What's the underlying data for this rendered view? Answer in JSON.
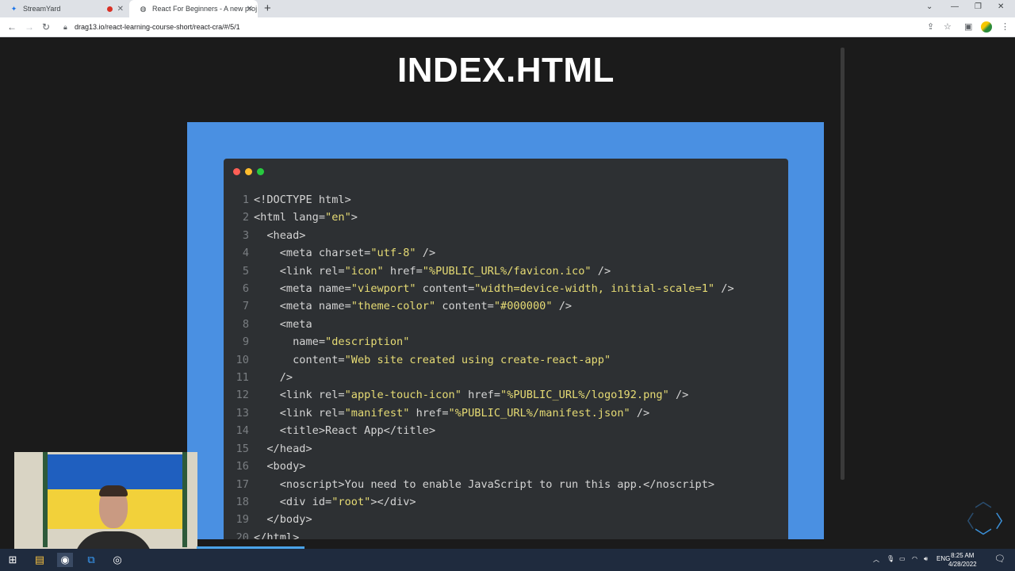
{
  "browser": {
    "tabs": [
      {
        "title": "StreamYard",
        "recording": true
      },
      {
        "title": "React For Beginners - A new proj",
        "active": true
      }
    ],
    "url": "drag13.io/react-learning-course-short/react-cra/#/5/1"
  },
  "slide": {
    "title": "INDEX.HTML",
    "code_lines": [
      {
        "n": "1",
        "t": "<!DOCTYPE html>"
      },
      {
        "n": "2",
        "t": "<html lang=\"en\">"
      },
      {
        "n": "3",
        "t": "  <head>"
      },
      {
        "n": "4",
        "t": "    <meta charset=\"utf-8\" />"
      },
      {
        "n": "5",
        "t": "    <link rel=\"icon\" href=\"%PUBLIC_URL%/favicon.ico\" />"
      },
      {
        "n": "6",
        "t": "    <meta name=\"viewport\" content=\"width=device-width, initial-scale=1\" />"
      },
      {
        "n": "7",
        "t": "    <meta name=\"theme-color\" content=\"#000000\" />"
      },
      {
        "n": "8",
        "t": "    <meta"
      },
      {
        "n": "9",
        "t": "      name=\"description\""
      },
      {
        "n": "10",
        "t": "      content=\"Web site created using create-react-app\""
      },
      {
        "n": "11",
        "t": "    />"
      },
      {
        "n": "12",
        "t": "    <link rel=\"apple-touch-icon\" href=\"%PUBLIC_URL%/logo192.png\" />"
      },
      {
        "n": "13",
        "t": "    <link rel=\"manifest\" href=\"%PUBLIC_URL%/manifest.json\" />"
      },
      {
        "n": "14",
        "t": "    <title>React App</title>"
      },
      {
        "n": "15",
        "t": "  </head>"
      },
      {
        "n": "16",
        "t": "  <body>"
      },
      {
        "n": "17",
        "t": "    <noscript>You need to enable JavaScript to run this app.</noscript>"
      },
      {
        "n": "18",
        "t": "    <div id=\"root\"></div>"
      },
      {
        "n": "19",
        "t": "  </body>"
      },
      {
        "n": "20",
        "t": "</html>"
      }
    ],
    "progress": 0.17
  },
  "taskbar": {
    "lang": "ENG",
    "time": "8:25 AM",
    "date": "4/28/2022"
  },
  "colors": {
    "slide_bg": "#1b1b1b",
    "frame_blue": "#4a90e2",
    "editor_bg": "#2d3033",
    "string": "#e6db74",
    "dot_red": "#ff5f56",
    "dot_yellow": "#ffbd2e",
    "dot_green": "#27c93f"
  }
}
